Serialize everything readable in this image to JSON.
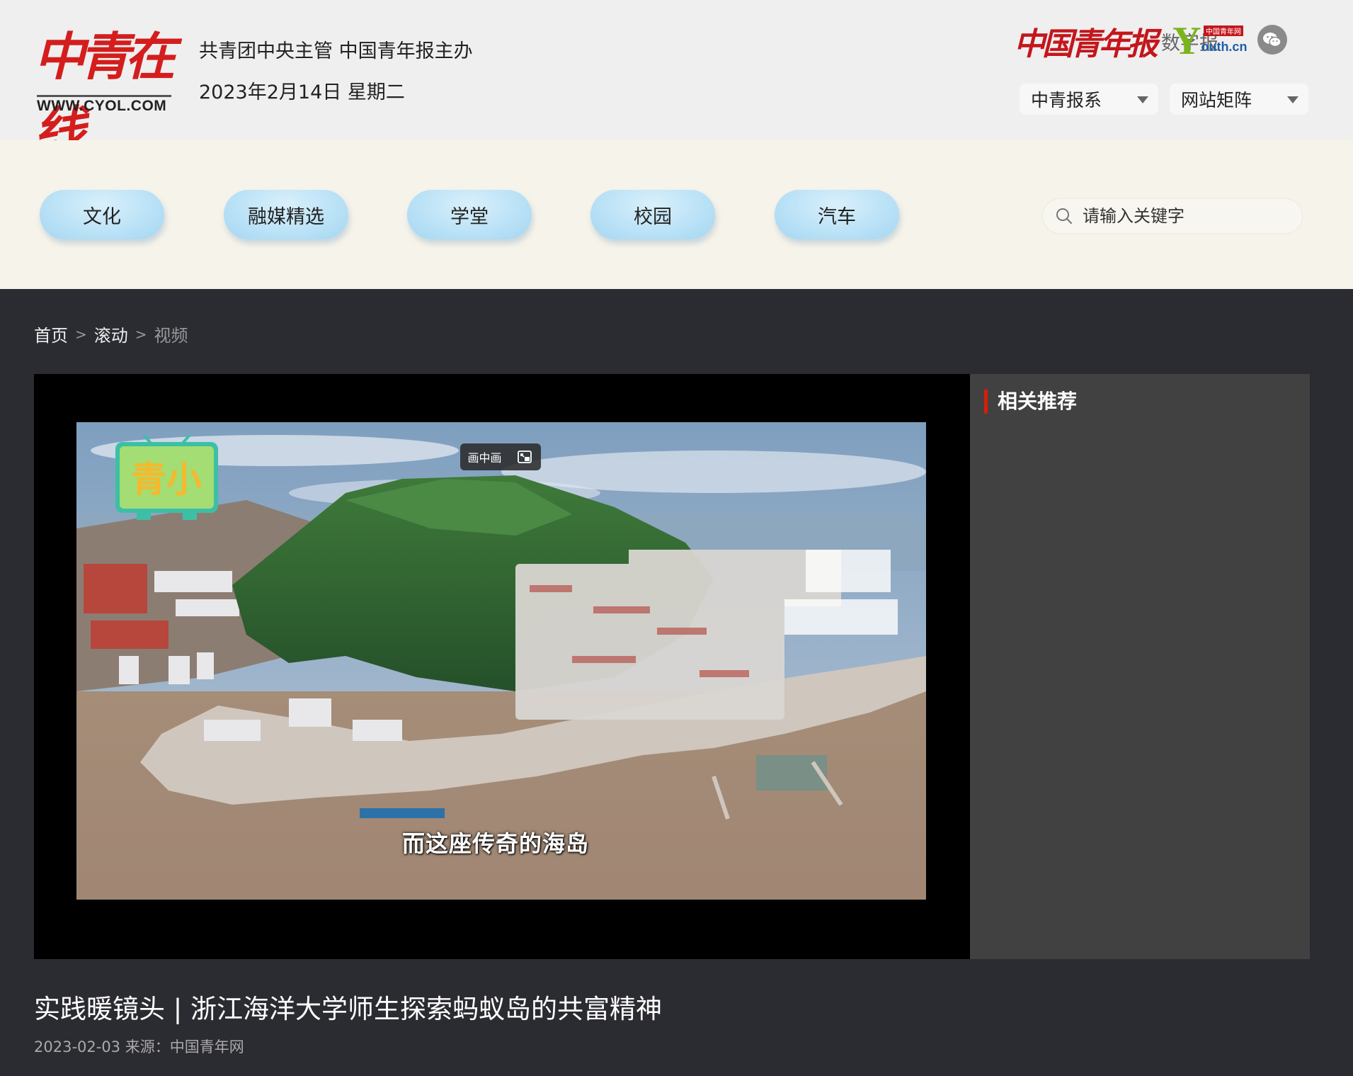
{
  "header": {
    "logo_text": "中青在线",
    "logo_url": "WWW.CYOL.COM",
    "sponsor": "共青团中央主管 中国青年报主办",
    "date": "2023年2月14日 星期二",
    "partners": {
      "paper_name": "中国青年报",
      "paper_suffix": "数字报",
      "youth_tag": "中国青年网",
      "youth_y": "Y",
      "youth_rest": "outh.cn"
    },
    "dropdowns": [
      {
        "label": "中青报系"
      },
      {
        "label": "网站矩阵"
      }
    ]
  },
  "nav": {
    "items": [
      {
        "label": "文化"
      },
      {
        "label": "融媒精选"
      },
      {
        "label": "学堂"
      },
      {
        "label": "校园"
      },
      {
        "label": "汽车"
      }
    ],
    "search": {
      "placeholder": "请输入关键字"
    }
  },
  "breadcrumb": {
    "items": [
      "首页",
      "滚动",
      "视频"
    ],
    "separator": ">"
  },
  "video": {
    "pip_label": "画中画",
    "channel_text": "青小",
    "subtitle": "而这座传奇的海岛"
  },
  "related": {
    "title": "相关推荐"
  },
  "article": {
    "title": "实践暖镜头 | 浙江海洋大学师生探索蚂蚁岛的共富精神",
    "meta": "2023-02-03 来源：中国青年网"
  },
  "colors": {
    "brand_red": "#d41d1d",
    "accent_red": "#d81e06",
    "nav_pill": "#b9e1f6",
    "page_dark": "#2b2b32",
    "related_bg": "#414141"
  }
}
